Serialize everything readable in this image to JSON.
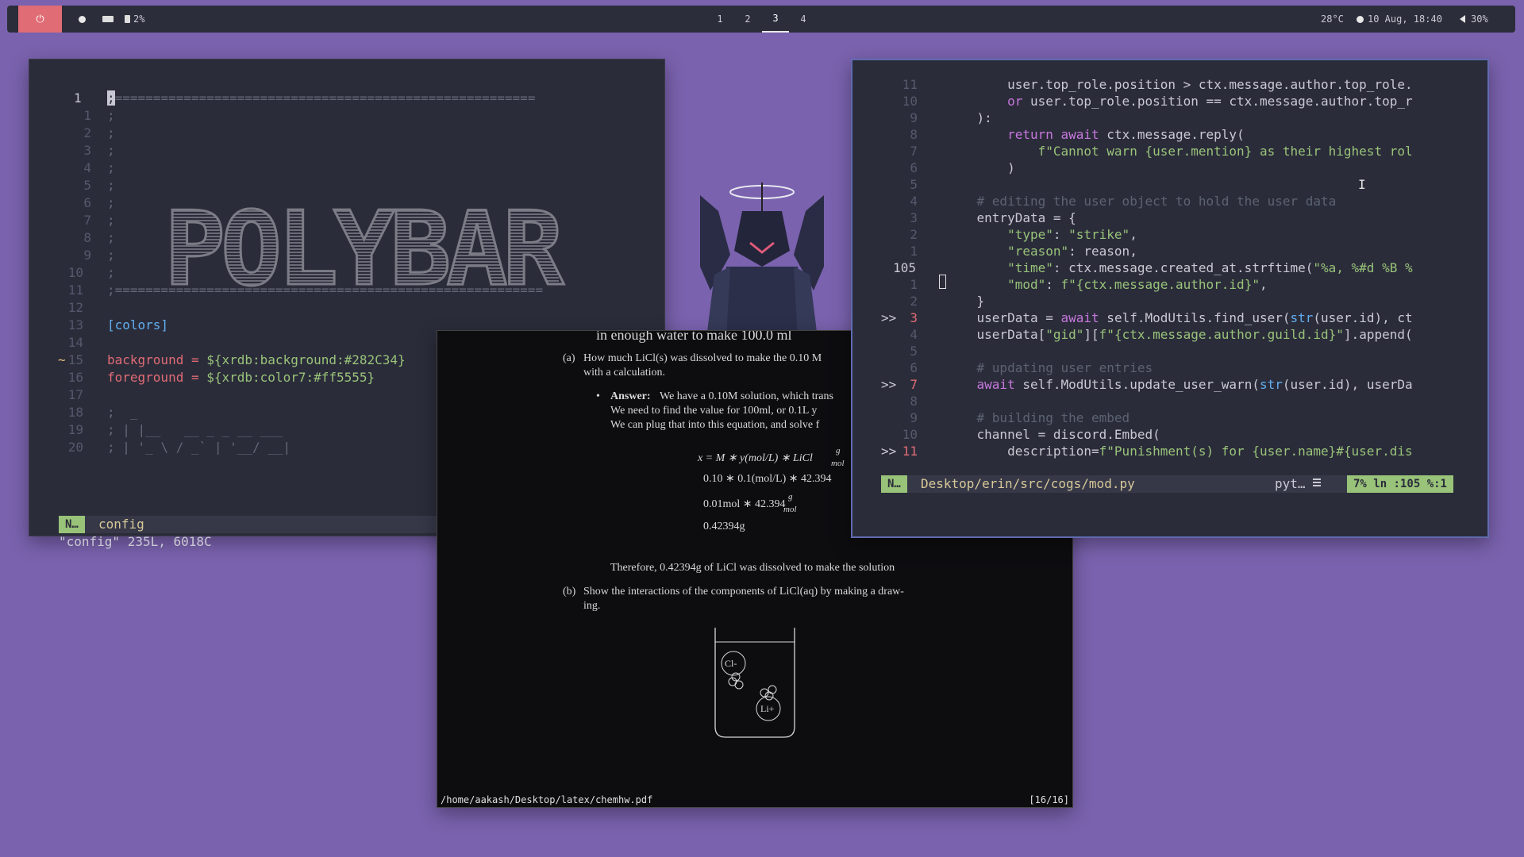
{
  "topbar": {
    "cpu_label": "2%",
    "workspaces": [
      "1",
      "2",
      "3",
      "4"
    ],
    "active_workspace": "3",
    "temperature": "28°C",
    "datetime": "10 Aug, 18:40",
    "volume": "30%",
    "colors": {
      "power": "#e06c75",
      "bar": "#2b2d3a"
    }
  },
  "left_editor": {
    "line_numbers": [
      "1",
      "1",
      "2",
      "3",
      "4",
      "5",
      "6",
      "7",
      "8",
      "9",
      "10",
      "11",
      "12",
      "13",
      "14",
      "15",
      "16",
      "17",
      "18",
      "19",
      "20"
    ],
    "line1_text": "=======================================================",
    "ascii_title": "POLYBAR",
    "rule_line": ";========================================================",
    "section": "[colors]",
    "bg_line_key": "background = ",
    "bg_line_val": "${xrdb:background:#282C34}",
    "fg_line_key": "foreground = ",
    "fg_line_val": "${xrdb:color7:#ff5555}",
    "line18": ";  _",
    "line19": "; | |__   __ _ _ __ ___",
    "line20": "; | '_ \\ / _` | '__/ __|",
    "tilde": "~",
    "mode": "N…",
    "filename": "config",
    "message": "\"config\" 235L, 6018C"
  },
  "pdf": {
    "top_line": "in enough water to make 100.0 ml",
    "q_a_label": "(a)",
    "q_a": "How much LiCl(s) was dissolved to make the 0.10 M",
    "q_a2": "with a calculation.",
    "answer_label": "Answer:",
    "answer_1": "We have a 0.10M solution, which trans",
    "answer_2": "We need to find the value for 100ml, or 0.1L y",
    "answer_3": "We can plug that into this equation, and solve f",
    "eq1": "x = M ∗ y(mol/L) ∗ LiCl",
    "eq2": "0.10 ∗ 0.1(mol/L) ∗ 42.394",
    "eq3": "0.01mol ∗ 42.394",
    "eq4": "0.42394g",
    "frac_num": "g",
    "frac_den": "mol",
    "therefore": "Therefore, 0.42394g of LiCl was dissolved to make the solution",
    "q_b_label": "(b)",
    "q_b": "Show the interactions of the components of LiCl(aq) by making a draw-",
    "q_b2": "ing.",
    "ion_cl": "Cl-",
    "ion_li": "Li+",
    "path": "/home/aakash/Desktop/latex/chemhw.pdf",
    "page": "[16/16]"
  },
  "right_editor": {
    "rel_numbers": [
      "11",
      "10",
      "9",
      "8",
      "7",
      "6",
      "5",
      "4",
      "3",
      "2",
      "1",
      "105",
      "1",
      "2",
      "3",
      "4",
      "5",
      "6",
      "7",
      "8",
      "9",
      "10",
      "11"
    ],
    "markers": {
      "3": ">>",
      "7": ">>",
      "11": ">>"
    },
    "code": [
      "        user.top_role.position > ctx.message.author.top_role.",
      "        or user.top_role.position == ctx.message.author.top_r",
      "    ):",
      "        return await ctx.message.reply(",
      "            f\"Cannot warn {user.mention} as their highest rol",
      "        )",
      "",
      "    # editing the user object to hold the user data",
      "    entryData = {",
      "        \"type\": \"strike\",",
      "        \"reason\": reason,",
      "        \"time\": ctx.message.created_at.strftime(\"%a, %#d %B %",
      "        \"mod\": f\"{ctx.message.author.id}\",",
      "    }",
      "    userData = await self.ModUtils.find_user(str(user.id), ct",
      "    userData[\"gid\"][f\"{ctx.message.author.guild.id}\"].append(",
      "",
      "    # updating user entries",
      "    await self.ModUtils.update_user_warn(str(user.id), userDa",
      "",
      "    # building the embed",
      "    channel = discord.Embed(",
      "        description=f\"Punishment(s) for {user.name}#{user.dis"
    ],
    "mode": "N…",
    "filepath": "Desktop/erin/src/cogs/mod.py",
    "filetype": "pyt…",
    "position": "7%  ln :105 %:1"
  }
}
